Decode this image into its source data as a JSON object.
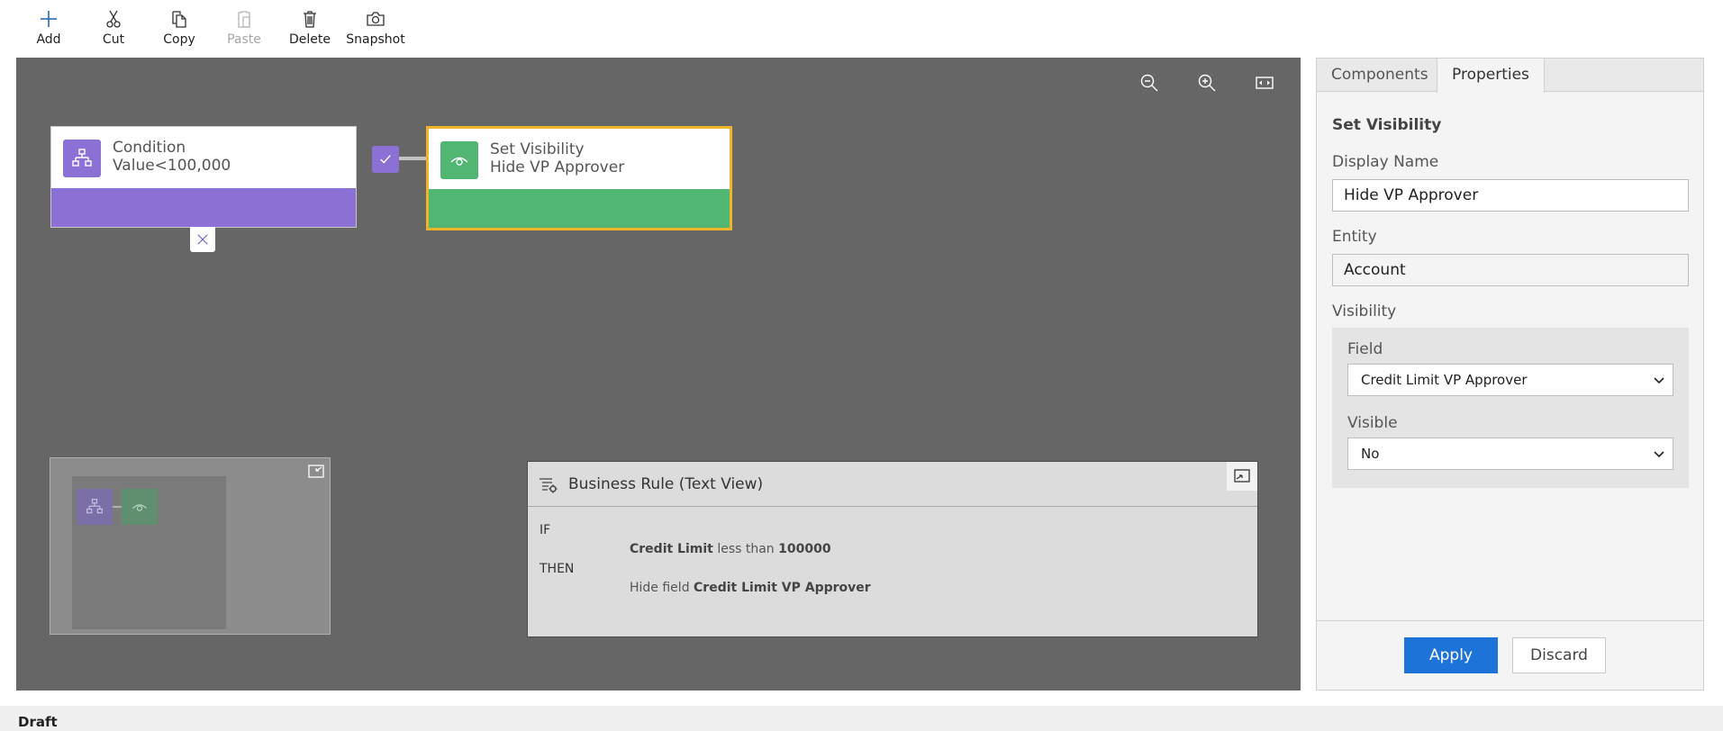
{
  "toolbar": {
    "add": "Add",
    "cut": "Cut",
    "copy": "Copy",
    "paste": "Paste",
    "delete": "Delete",
    "snapshot": "Snapshot"
  },
  "canvas": {
    "condition": {
      "title": "Condition",
      "subtitle": "Value<100,000",
      "color": "#8b71d6"
    },
    "action": {
      "title": "Set Visibility",
      "subtitle": "Hide VP Approver",
      "color": "#52b673",
      "selected_border": "#f0b429"
    }
  },
  "text_view": {
    "title": "Business Rule (Text View)",
    "if_kw": "IF",
    "if_field": "Credit Limit",
    "if_op": "less than",
    "if_value": "100000",
    "then_kw": "THEN",
    "then_action": "Hide field",
    "then_field": "Credit Limit VP Approver"
  },
  "panel": {
    "tabs": [
      "Components",
      "Properties"
    ],
    "active_tab": "Properties",
    "section_title": "Set Visibility",
    "display_name_label": "Display Name",
    "display_name_value": "Hide VP Approver",
    "entity_label": "Entity",
    "entity_value": "Account",
    "visibility_label": "Visibility",
    "field_label": "Field",
    "field_value": "Credit Limit VP Approver",
    "visible_label": "Visible",
    "visible_value": "No",
    "apply": "Apply",
    "discard": "Discard"
  },
  "status": {
    "text": "Draft"
  }
}
